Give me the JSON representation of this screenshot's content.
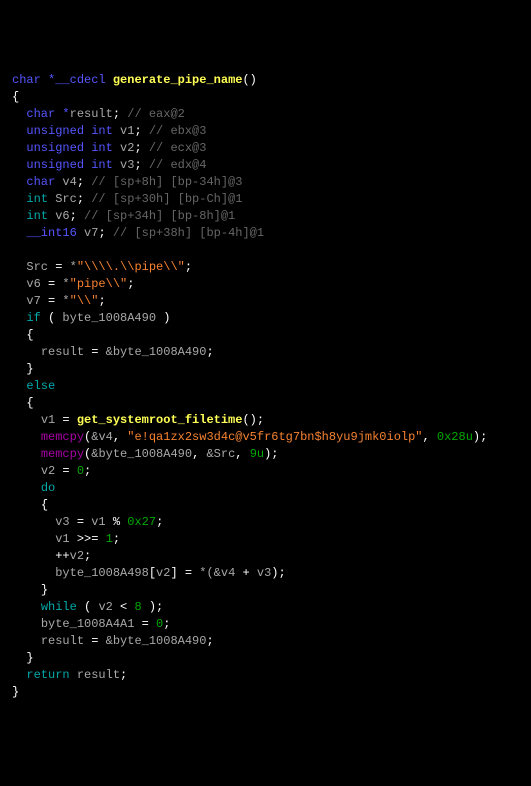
{
  "code": {
    "ret_type_ptr": "char *",
    "callconv": "__cdecl",
    "fn_name": "generate_pipe_name",
    "parens": "()",
    "lbrace": "{",
    "rbrace": "}",
    "decl": {
      "d1_t": "char *",
      "d1_v": "result",
      "d1_c": "// eax@2",
      "d2_t": "unsigned int",
      "d2_v": "v1",
      "d2_c": "// ebx@3",
      "d3_t": "unsigned int",
      "d3_v": "v2",
      "d3_c": "// ecx@3",
      "d4_t": "unsigned int",
      "d4_v": "v3",
      "d4_c": "// edx@4",
      "d5_t": "char",
      "d5_v": "v4",
      "d5_c": "// [sp+8h] [bp-34h]@3",
      "d6_t": "int",
      "d6_v": "Src",
      "d6_c": "// [sp+30h] [bp-Ch]@1",
      "d7_t": "int",
      "d7_v": "v6",
      "d7_c": "// [sp+34h] [bp-8h]@1",
      "d8_t": "__int16",
      "d8_v": "v7",
      "d8_c": "// [sp+38h] [bp-4h]@1"
    },
    "body": {
      "src_lhs": "Src",
      "src_str": "\"\\\\\\\\.\\\\pipe\\\\\"",
      "v6_lhs": "v6",
      "v6_str": "\"pipe\\\\\"",
      "v7_lhs": "v7",
      "v7_str": "\"\\\\\"",
      "if_kw": "if",
      "if_cond": "byte_1008A490",
      "then_result": "result",
      "then_addr": "byte_1008A490",
      "else_kw": "else",
      "v1_assign": "v1",
      "call1": "get_systemroot_filetime",
      "empty_args": "()",
      "memcpy": "memcpy",
      "mc1_dst": "v4",
      "mc1_str": "\"e!qa1zx2sw3d4c@v5fr6tg7bn$h8yu9jmk0iolp\"",
      "mc1_n_hex": "0x28u",
      "mc2_dst": "byte_1008A490",
      "mc2_src": "Src",
      "mc2_n": "9u",
      "v2_assign": "v2",
      "zero": "0",
      "do_kw": "do",
      "v3_assign": "v3",
      "v1_ref": "v1",
      "mod_hex": "0x27",
      "shr_lhs": "v1",
      "shr_n": "1",
      "inc_pp": "++",
      "inc_v": "v2",
      "idx_lhs": "byte_1008A498",
      "idx_i": "v2",
      "idx_r1": "v4",
      "idx_r2": "v3",
      "while_kw": "while",
      "while_v": "v2",
      "while_n": "8",
      "zterm_lhs": "byte_1008A4A1",
      "zterm_n": "0",
      "res2": "result",
      "res2_addr": "byte_1008A490",
      "return_kw": "return",
      "return_v": "result"
    }
  }
}
